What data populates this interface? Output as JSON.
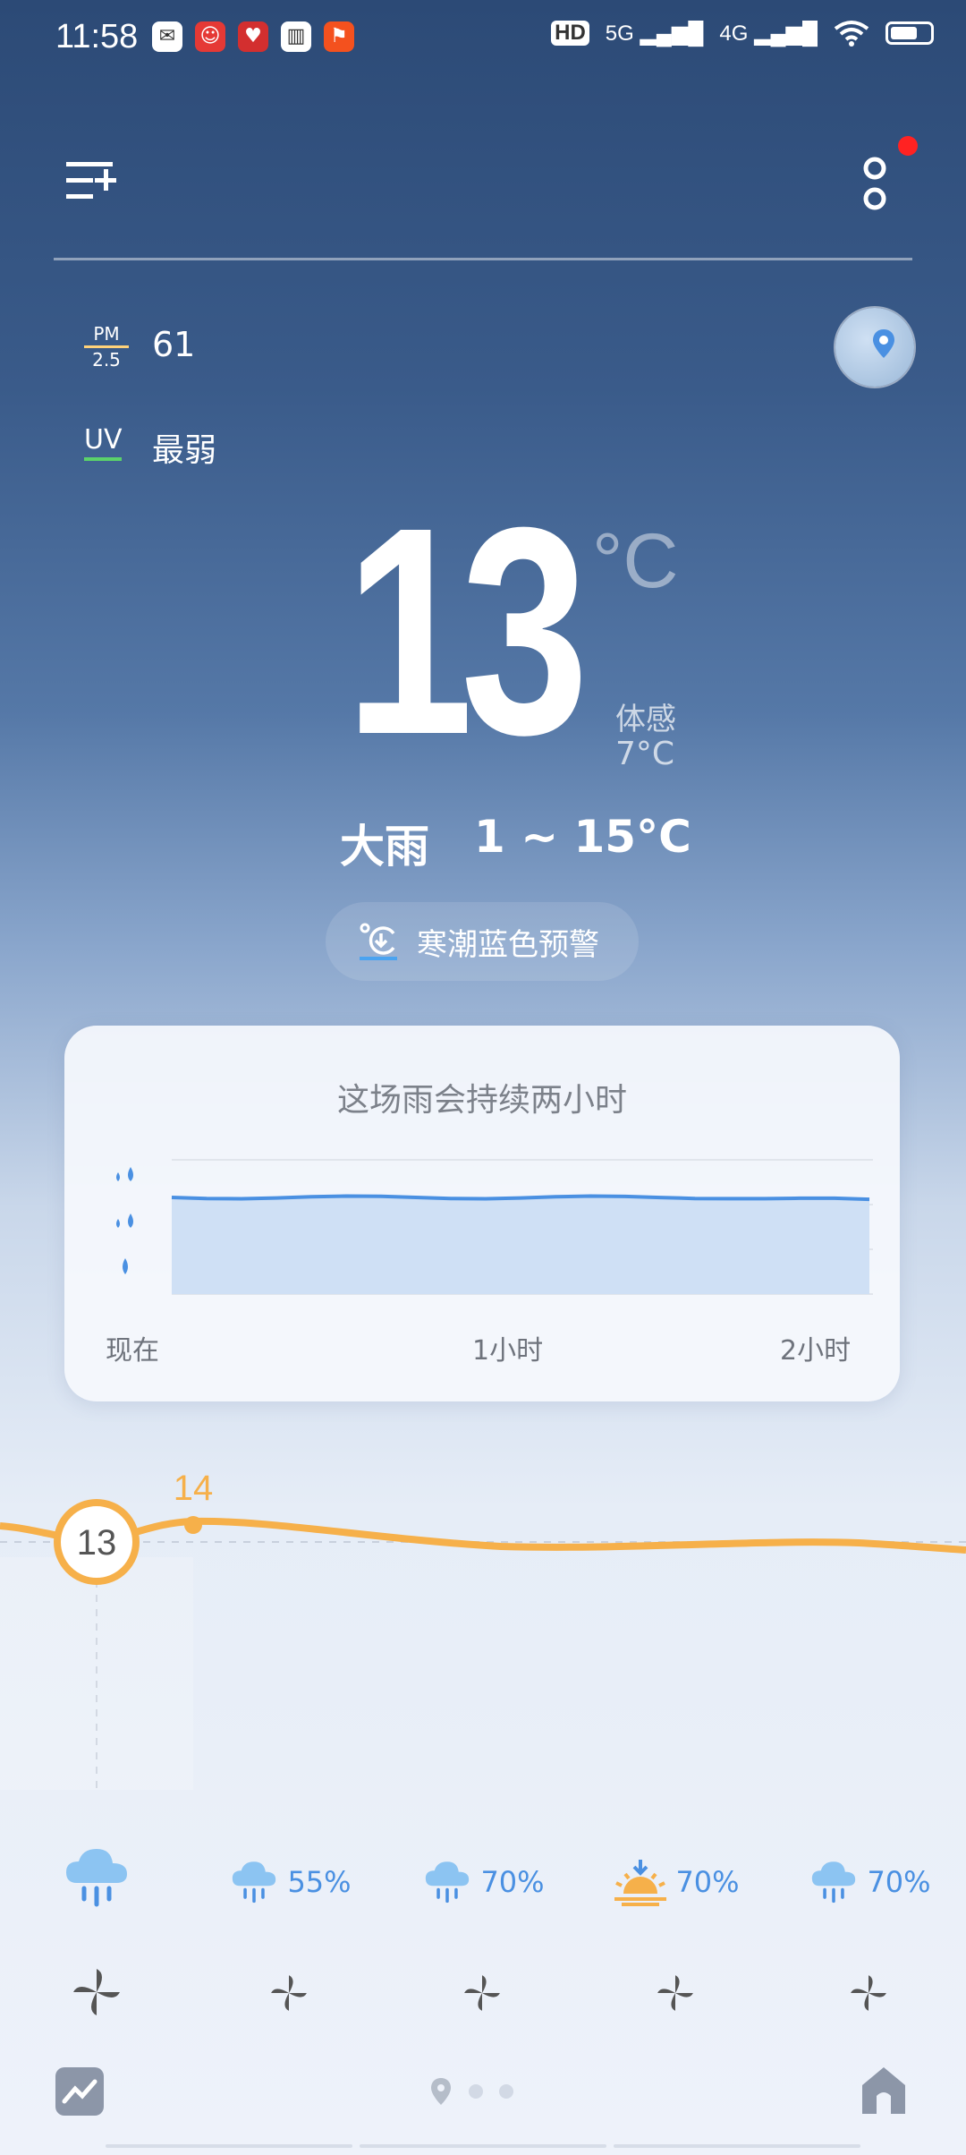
{
  "status_bar": {
    "time": "11:58",
    "network": [
      "HD",
      "5G",
      "4G"
    ],
    "icons": [
      "mail-icon",
      "app-icon-1",
      "app-icon-2",
      "book-icon",
      "app-icon-3",
      "wifi-icon",
      "battery-icon"
    ]
  },
  "header": {
    "city": ""
  },
  "air": {
    "pm_label_top": "PM",
    "pm_label_bottom": "2.5",
    "pm_value": "61",
    "uv_label": "UV",
    "uv_value": "最弱"
  },
  "current": {
    "temperature": "13",
    "unit": "°C",
    "feels_label": "体感",
    "feels_value": "7°C",
    "condition": "大雨",
    "range": "1 ~ 15°C"
  },
  "warning": {
    "text": "寒潮蓝色预警"
  },
  "rain_card": {
    "title": "这场雨会持续两小时",
    "x_labels": [
      "现在",
      "1小时",
      "2小时"
    ],
    "intensity_level": 0.72
  },
  "hourly": {
    "current_temp": "13",
    "peak_temp": "14",
    "items": [
      {
        "icon": "cloud-rain-icon",
        "pop": ""
      },
      {
        "icon": "cloud-rain-icon",
        "pop": "55%"
      },
      {
        "icon": "cloud-rain-icon",
        "pop": "70%"
      },
      {
        "icon": "sunrise-icon",
        "pop": "70%"
      },
      {
        "icon": "cloud-rain-icon",
        "pop": "70%"
      }
    ]
  },
  "colors": {
    "accent_orange": "#f6b04a",
    "rain_blue": "#4a90e2",
    "red_dot": "#ff2222"
  }
}
